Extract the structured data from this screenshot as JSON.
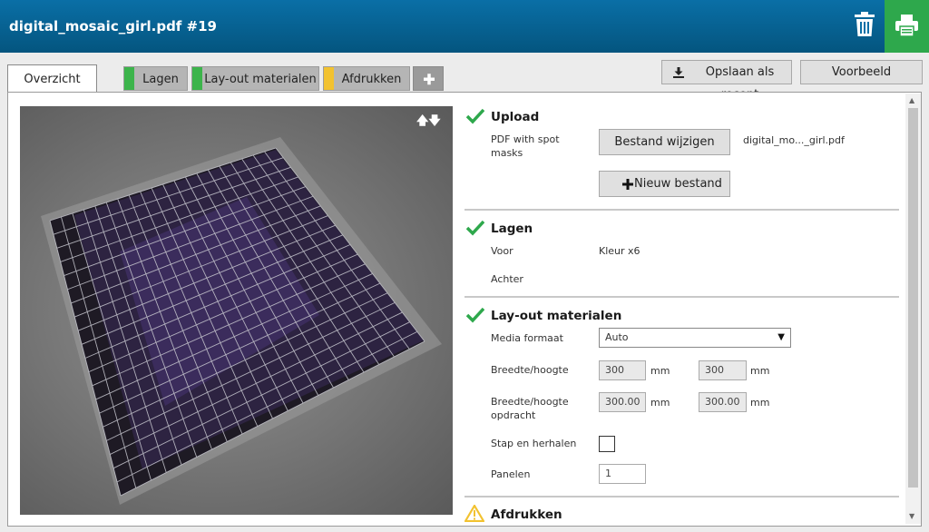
{
  "header": {
    "title": "digital_mosaic_girl.pdf #19",
    "delete_icon": "trash-icon",
    "print_icon": "printer-icon",
    "accent_color": "#0a6fa6",
    "print_color": "#2ea84c"
  },
  "tabs": [
    {
      "label": "Overzicht",
      "active": true
    },
    {
      "label": "Lagen",
      "status_color": "#3cb44b"
    },
    {
      "label": "Lay-out materialen",
      "status_color": "#3cb44b"
    },
    {
      "label": "Afdrukken",
      "status_color": "#f2c230"
    },
    {
      "label": "+",
      "icon": "plus-icon"
    }
  ],
  "toolbar": {
    "save_label": "Opslaan als recept",
    "save_icon": "download-icon",
    "preview_label": "Voorbeeld"
  },
  "preview": {
    "arrows": "🡅🡇"
  },
  "upload": {
    "title": "Upload",
    "file_type": "PDF with spot masks",
    "change_label": "Bestand wijzigen",
    "file_name": "digital_mo..._girl.pdf",
    "new_label": "Nieuw bestand"
  },
  "lagen": {
    "title": "Lagen",
    "front_label": "Voor",
    "front_value": "Kleur x6",
    "back_label": "Achter"
  },
  "layout": {
    "title": "Lay-out materialen",
    "media_label": "Media formaat",
    "media_value": "Auto",
    "size_label": "Breedte/hoogte",
    "width": "300",
    "height": "300",
    "unit": "mm",
    "job_size_label": "Breedte/hoogte opdracht",
    "job_width": "300.00",
    "job_height": "300.00",
    "step_repeat_label": "Stap en herhalen",
    "panels_label": "Panelen",
    "panels_value": "1"
  },
  "print": {
    "title": "Afdrukken",
    "status_icon": "warning-icon"
  }
}
